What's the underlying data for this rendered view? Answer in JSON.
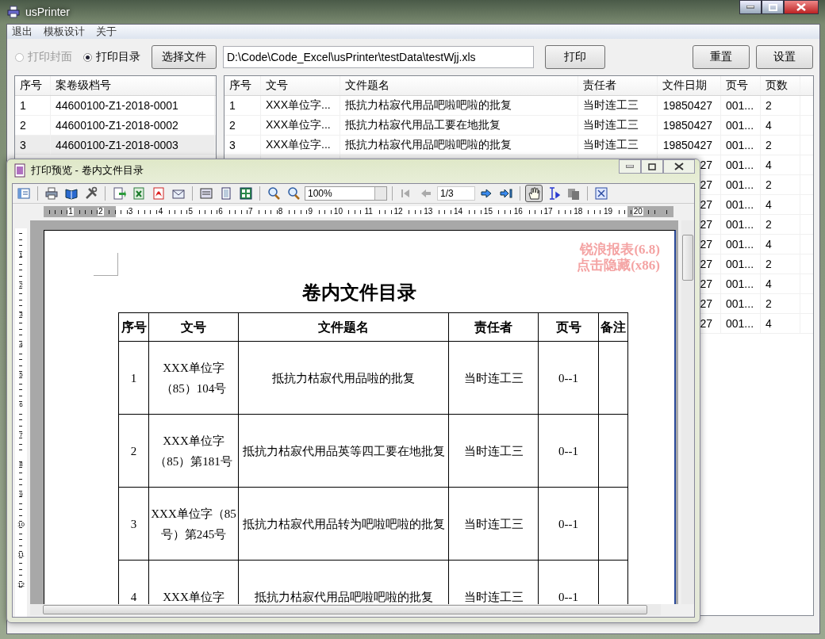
{
  "window": {
    "title": "usPrinter"
  },
  "menu": [
    "退出",
    "模板设计",
    "关于"
  ],
  "options": [
    {
      "label": "打印封面",
      "selected": false,
      "disabled": true
    },
    {
      "label": "打印目录",
      "selected": true,
      "disabled": false
    }
  ],
  "choose_button": "选择文件",
  "file_path": "D:\\Code\\Code_Excel\\usPrinter\\testData\\testWjj.xls",
  "print_button": "打印",
  "reset_button": "重置",
  "settings_button": "设置",
  "volumes": {
    "columns": [
      "序号",
      "案卷级档号"
    ],
    "rows": [
      {
        "no": "1",
        "code": "44600100-Z1-2018-0001",
        "selected": false
      },
      {
        "no": "2",
        "code": "44600100-Z1-2018-0002",
        "selected": false
      },
      {
        "no": "3",
        "code": "44600100-Z1-2018-0003",
        "selected": true
      }
    ]
  },
  "files": {
    "columns": [
      "序号",
      "文号",
      "文件题名",
      "责任者",
      "文件日期",
      "页号",
      "页数"
    ],
    "rows": [
      {
        "no": "1",
        "doc_no": "XXX单位字...",
        "title": "抵抗力枯寂代用品吧啦吧啦的批复",
        "owner": "当时连工三",
        "date": "19850427",
        "page_no": "001...",
        "pages": "2"
      },
      {
        "no": "2",
        "doc_no": "XXX单位字...",
        "title": "抵抗力枯寂代用品工要在地批复",
        "owner": "当时连工三",
        "date": "19850427",
        "page_no": "001...",
        "pages": "4"
      },
      {
        "no": "3",
        "doc_no": "XXX单位字...",
        "title": "抵抗力枯寂代用品吧啦吧啦的批复",
        "owner": "当时连工三",
        "date": "19850427",
        "page_no": "001...",
        "pages": "2"
      },
      {
        "date": "27",
        "page_no": "001...",
        "pages": "4"
      },
      {
        "date": "27",
        "page_no": "001...",
        "pages": "2"
      },
      {
        "date": "27",
        "page_no": "001...",
        "pages": "4"
      },
      {
        "date": "27",
        "page_no": "001...",
        "pages": "2"
      },
      {
        "date": "27",
        "page_no": "001...",
        "pages": "4"
      },
      {
        "date": "27",
        "page_no": "001...",
        "pages": "2"
      },
      {
        "date": "27",
        "page_no": "001...",
        "pages": "4"
      },
      {
        "date": "27",
        "page_no": "001...",
        "pages": "2"
      },
      {
        "date": "27",
        "page_no": "001...",
        "pages": "4"
      }
    ]
  },
  "preview": {
    "title": "打印预览 - 卷内文件目录",
    "zoom": "100%",
    "page": "1/3",
    "pan_mode": true,
    "ruler_h": [
      "1",
      "2",
      "3",
      "4",
      "5",
      "6",
      "7",
      "8",
      "9",
      "10",
      "11",
      "12",
      "13",
      "14",
      "15",
      "16",
      "17",
      "18",
      "19",
      "20"
    ],
    "ruler_v": [
      "1",
      "2",
      "3",
      "4",
      "5",
      "6",
      "7",
      "8",
      "9",
      "10",
      "11",
      "12"
    ],
    "watermark": [
      "锐浪报表(6.8)",
      "点击隐藏(x86)"
    ],
    "report": {
      "title": "卷内文件目录",
      "columns": [
        "序号",
        "文号",
        "文件题名",
        "责任者",
        "页号",
        "备注"
      ],
      "rows": [
        {
          "no": "1",
          "doc_no": "XXX单位字（85）104号",
          "title": "抵抗力枯寂代用品啦的批复",
          "owner": "当时连工三",
          "page_no": "0--1"
        },
        {
          "no": "2",
          "doc_no": "XXX单位字（85）第181号",
          "title": "抵抗力枯寂代用品英等四工要在地批复",
          "owner": "当时连工三",
          "page_no": "0--1"
        },
        {
          "no": "3",
          "doc_no": "XXX单位字（85号）第245号",
          "title": "抵抗力枯寂代用品转为吧啦吧啦的批复",
          "owner": "当时连工三",
          "page_no": "0--1"
        },
        {
          "no": "4",
          "doc_no": "XXX单位字",
          "title": "抵抗力枯寂代用品吧啦吧啦的批复",
          "owner": "当时连工三",
          "page_no": "0--1"
        }
      ]
    }
  }
}
